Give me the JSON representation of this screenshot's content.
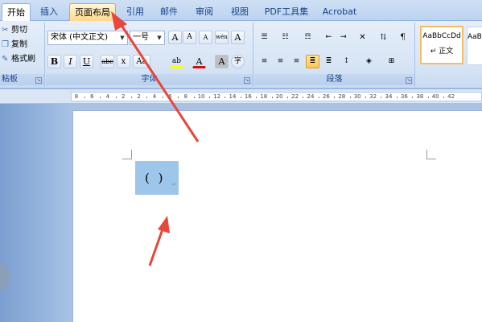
{
  "tabs": [
    {
      "label": "开始",
      "state": "active"
    },
    {
      "label": "插入",
      "state": "normal"
    },
    {
      "label": "页面布局",
      "state": "highlighted"
    },
    {
      "label": "引用",
      "state": "normal"
    },
    {
      "label": "邮件",
      "state": "normal"
    },
    {
      "label": "审阅",
      "state": "normal"
    },
    {
      "label": "视图",
      "state": "normal"
    },
    {
      "label": "PDF工具集",
      "state": "normal"
    },
    {
      "label": "Acrobat",
      "state": "normal"
    }
  ],
  "clipboard": {
    "cut": "剪切",
    "copy": "复制",
    "format_painter": "格式刷",
    "group_label": "粘板"
  },
  "font": {
    "name": "宋体 (中文正文)",
    "size": "一号",
    "group_label": "字体",
    "buttons": {
      "grow": "A",
      "shrink": "A",
      "clear": "A",
      "phonetic": "wén",
      "border_char": "A",
      "bold": "B",
      "italic": "I",
      "underline": "U",
      "strike": "abc",
      "subscript": "x",
      "change_case": "Aa",
      "highlight": "ab",
      "font_color": "A",
      "shading": "A",
      "enclose": "字"
    }
  },
  "paragraph": {
    "group_label": "段落"
  },
  "styles": {
    "sample": "AaBbCcDd",
    "normal_label": "正文",
    "sample2": "AaBbC"
  },
  "ruler": {
    "ticks": [
      "8",
      "6",
      "4",
      "2",
      "2",
      "4",
      "6",
      "8",
      "10",
      "12",
      "14",
      "16",
      "18",
      "20",
      "22",
      "24",
      "26",
      "28",
      "30",
      "32",
      "34",
      "36",
      "38",
      "40",
      "42"
    ]
  },
  "document": {
    "selected_text": "( )",
    "paragraph_mark": "↵"
  },
  "colors": {
    "accent": "#15428b",
    "highlight_tab": "#ffd98a",
    "selection": "#9ec5ea",
    "arrow": "#e8473a"
  },
  "icons": {
    "cut": "scissors-icon",
    "copy": "copy-icon",
    "format_painter": "paintbrush-icon"
  }
}
